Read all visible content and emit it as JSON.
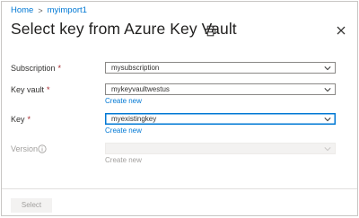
{
  "breadcrumb": {
    "home": "Home",
    "current": "myimport1"
  },
  "title": "Select key from Azure Key Vault",
  "form": {
    "subscription": {
      "label": "Subscription",
      "required": "*",
      "value": "mysubscription"
    },
    "key_vault": {
      "label": "Key vault",
      "required": "*",
      "value": "mykeyvaultwestus",
      "link": "Create new"
    },
    "key": {
      "label": "Key",
      "required": "*",
      "value": "myexistingkey",
      "link": "Create new"
    },
    "version": {
      "label": "Version",
      "value": "",
      "link": "Create new"
    }
  },
  "footer": {
    "select_label": "Select"
  },
  "icons": {
    "print": "print-icon",
    "close": "close-icon",
    "info": "info-icon",
    "chevron": "chevron-down-icon"
  },
  "colors": {
    "accent": "#0078d4",
    "required": "#a4262c",
    "disabled": "#a19f9d"
  }
}
